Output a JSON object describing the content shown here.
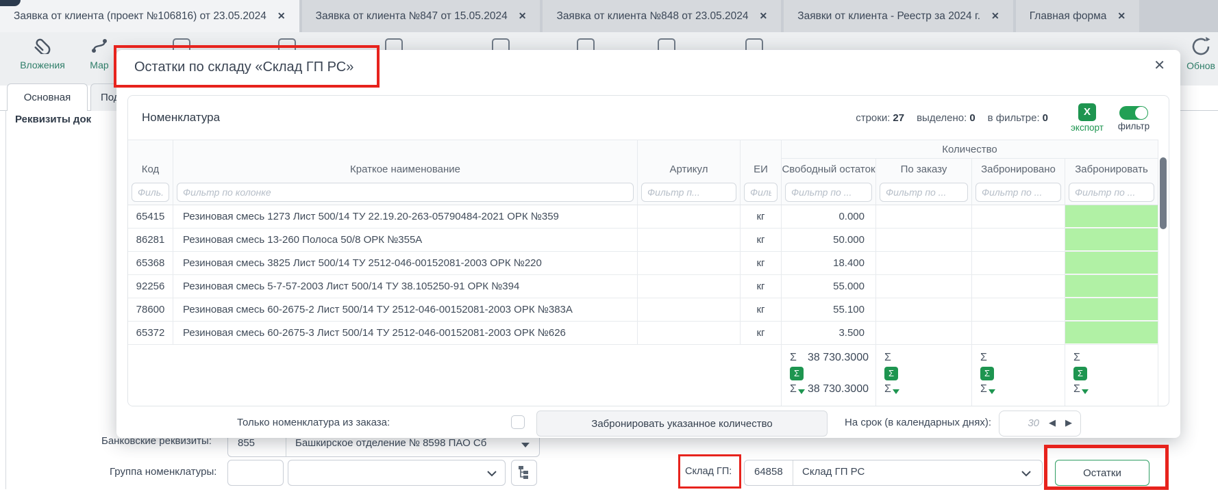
{
  "tabs": [
    {
      "label": "Заявка от клиента (проект №106816) от 23.05.2024",
      "active": true
    },
    {
      "label": "Заявка от клиента №847 от 15.05.2024",
      "active": false
    },
    {
      "label": "Заявка от клиента №848 от 23.05.2024",
      "active": false
    },
    {
      "label": "Заявки от клиента - Реестр за 2024 г.",
      "active": false
    },
    {
      "label": "Главная форма",
      "active": false
    }
  ],
  "icons": {
    "close": "✕",
    "sigma": "Σ",
    "excel": "X"
  },
  "toolbar": {
    "attachments_label": "Вложения",
    "marking_label": "Мар",
    "refresh_label": "Обнов"
  },
  "form_tabs": {
    "main": "Основная",
    "secondary": "Подп"
  },
  "section_title": "Реквизиты док",
  "modal": {
    "title": "Остатки по складу «Склад ГП РС»",
    "panel": {
      "title": "Номенклатура",
      "stats": [
        {
          "label": "строки:",
          "value": "27"
        },
        {
          "label": "выделено:",
          "value": "0"
        },
        {
          "label": "в фильтре:",
          "value": "0"
        }
      ],
      "export_label": "экспорт",
      "filter_label": "фильтр"
    },
    "table": {
      "group_header": "Количество",
      "columns": [
        "Код",
        "Краткое наименование",
        "Артикул",
        "ЕИ",
        "Свободный остаток",
        "По заказу",
        "Забронировано",
        "Забронировать"
      ],
      "filters": [
        "Филь...",
        "Фильтр по колонке",
        "Фильтр п...",
        "Филь...",
        "Фильтр по ...",
        "Фильтр по ...",
        "Фильтр по ...",
        "Фильтр по ..."
      ],
      "rows": [
        {
          "code": "65415",
          "name": "Резиновая смесь 1273 Лист 500/14 ТУ 22.19.20-263-05790484-2021 ОРК №359",
          "article": "",
          "unit": "кг",
          "free": "0.000",
          "by_order": "",
          "reserved": "",
          "to_reserve": ""
        },
        {
          "code": "86281",
          "name": "Резиновая смесь 13-260 Полоса 50/8 ОРК №355А",
          "article": "",
          "unit": "кг",
          "free": "50.000",
          "by_order": "",
          "reserved": "",
          "to_reserve": ""
        },
        {
          "code": "65368",
          "name": "Резиновая смесь 3825 Лист 500/14 ТУ 2512-046-00152081-2003 ОРК №220",
          "article": "",
          "unit": "кг",
          "free": "18.400",
          "by_order": "",
          "reserved": "",
          "to_reserve": ""
        },
        {
          "code": "92256",
          "name": "Резиновая смесь 5-7-57-2003 Лист 500/14 ТУ 38.105250-91 ОРК №394",
          "article": "",
          "unit": "кг",
          "free": "55.000",
          "by_order": "",
          "reserved": "",
          "to_reserve": ""
        },
        {
          "code": "78600",
          "name": "Резиновая смесь 60-2675-2 Лист 500/14 ТУ 2512-046-00152081-2003 ОРК №383А",
          "article": "",
          "unit": "кг",
          "free": "55.100",
          "by_order": "",
          "reserved": "",
          "to_reserve": ""
        },
        {
          "code": "65372",
          "name": "Резиновая смесь 60-2675-3 Лист 500/14 ТУ 2512-046-00152081-2003 ОРК №626",
          "article": "",
          "unit": "кг",
          "free": "3.500",
          "by_order": "",
          "reserved": "",
          "to_reserve": ""
        }
      ],
      "totals": [
        {
          "sum": "38 730.3000",
          "filtered": "38 730.3000"
        },
        {
          "sum": "",
          "filtered": ""
        },
        {
          "sum": "",
          "filtered": ""
        },
        {
          "sum": "",
          "filtered": ""
        }
      ]
    },
    "footer": {
      "only_from_order_label": "Только номенклатура из заказа:",
      "reserve_button": "Забронировать указанное количество",
      "term_label": "На срок (в календарных днях):",
      "term_value": "30"
    }
  },
  "bottom_form": {
    "bank_label": "Банковские реквизиты:",
    "bank_code": "855",
    "bank_name": "Башкирское отделение № 8598 ПАО Сб",
    "group_label": "Группа номенклатуры:",
    "warehouse_label": "Склад ГП:",
    "warehouse_code": "64858",
    "warehouse_name": "Склад ГП РС",
    "remains_button": "Остатки"
  },
  "colors": {
    "accent_green": "#1e9550",
    "toggle_green": "#22a055",
    "reserve_cell_green": "#b1f1a5",
    "annotation_red": "#e7231d",
    "toolbar_teal": "#2e7d68",
    "remains_border_green": "#2f9e63"
  }
}
